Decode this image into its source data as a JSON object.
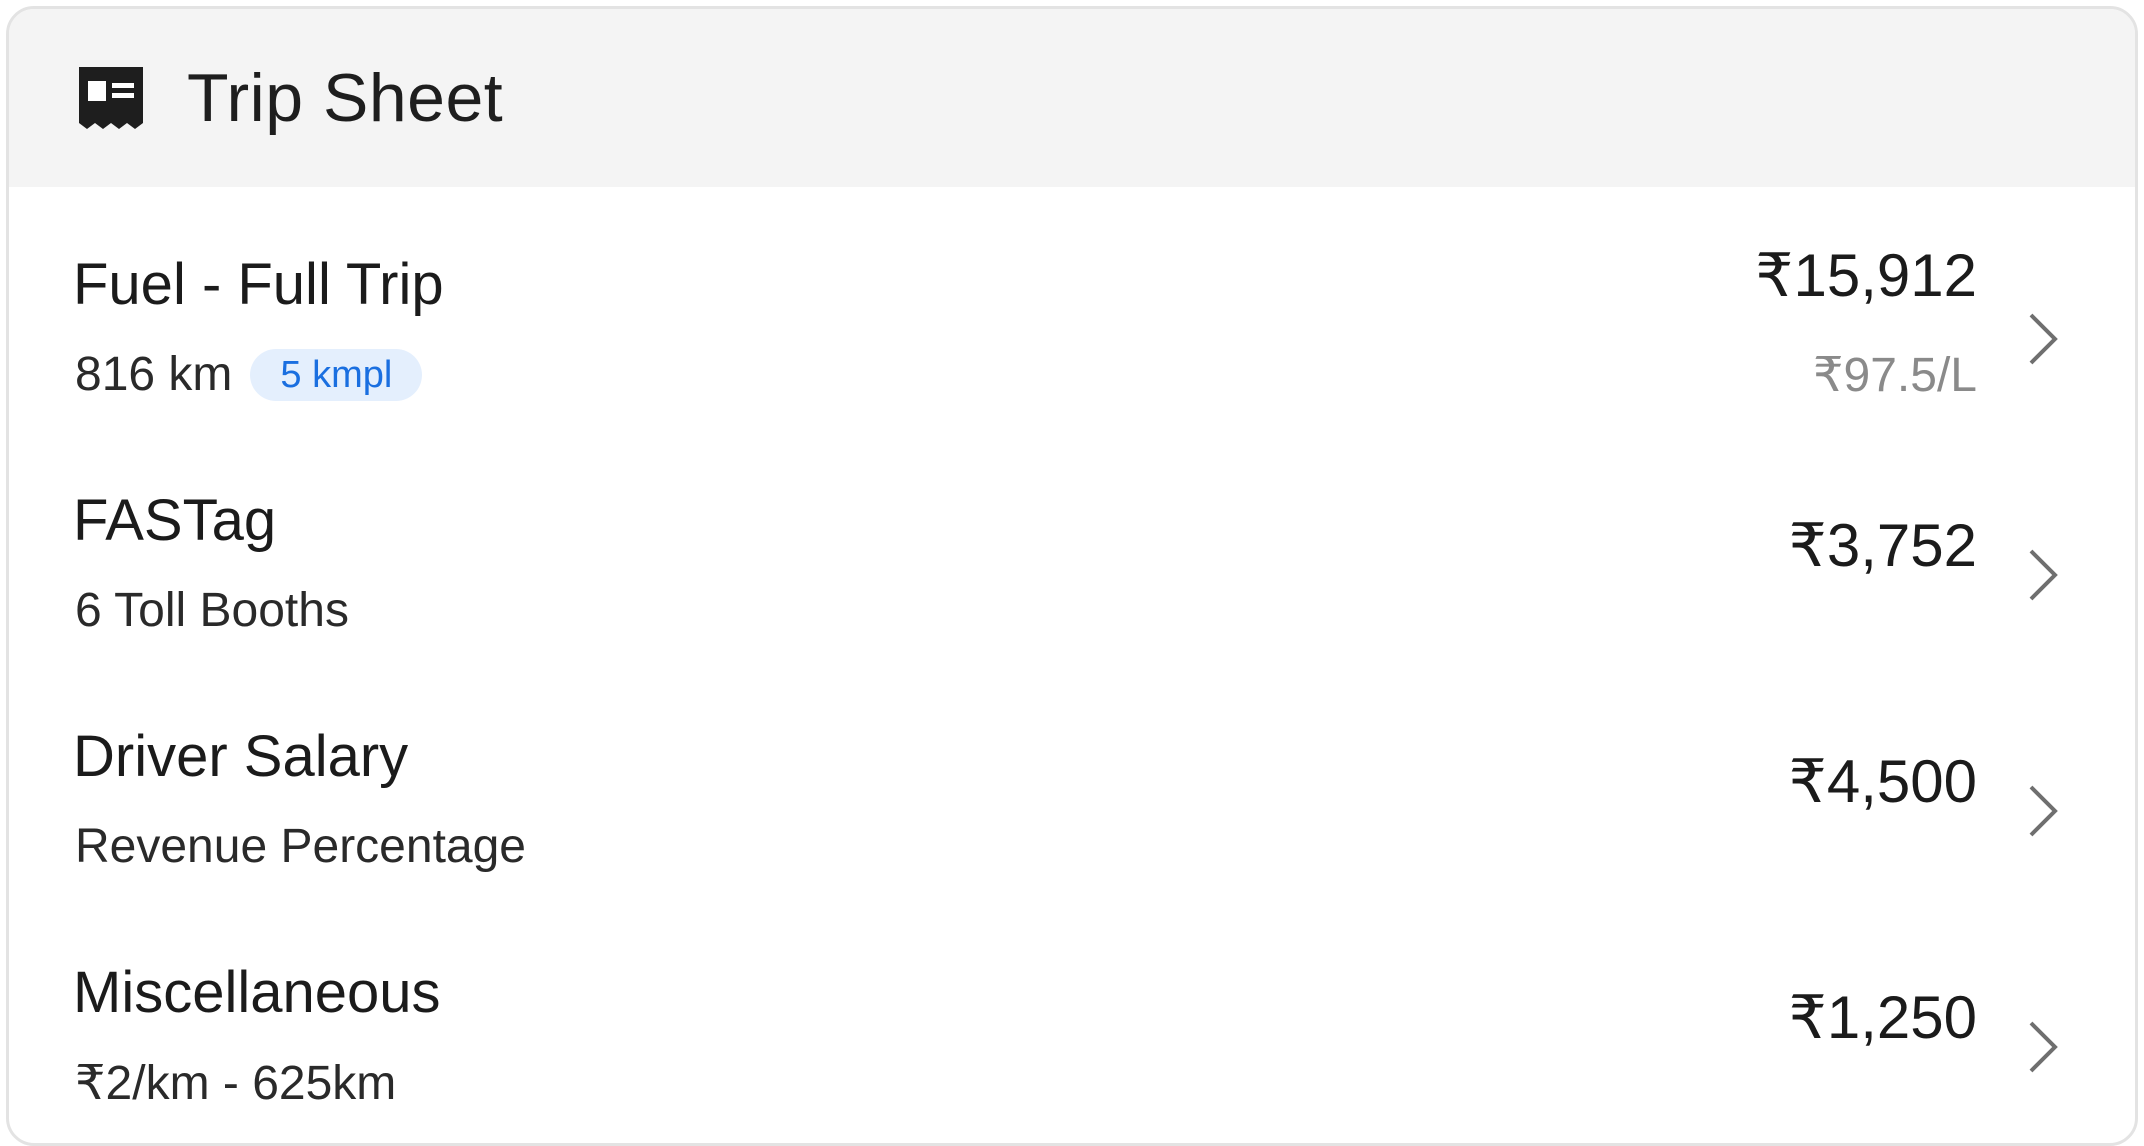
{
  "header": {
    "icon": "receipt-icon",
    "title": "Trip Sheet"
  },
  "rows": [
    {
      "title": "Fuel - Full Trip",
      "subtitle": "816 km",
      "badge": "5 kmpl",
      "amount": "₹15,912",
      "amount_sub": "₹97.5/L"
    },
    {
      "title": "FASTag",
      "subtitle": "6 Toll Booths",
      "amount": "₹3,752"
    },
    {
      "title": "Driver Salary",
      "subtitle": "Revenue Percentage",
      "amount": "₹4,500"
    },
    {
      "title": "Miscellaneous",
      "subtitle": "₹2/km - 625km",
      "amount": "₹1,250"
    }
  ],
  "colors": {
    "header_bg": "#f4f4f4",
    "badge_bg": "#e4effd",
    "badge_text": "#1a6fe0",
    "muted_text": "#8a8a8a",
    "chevron": "#6f6f6f"
  }
}
